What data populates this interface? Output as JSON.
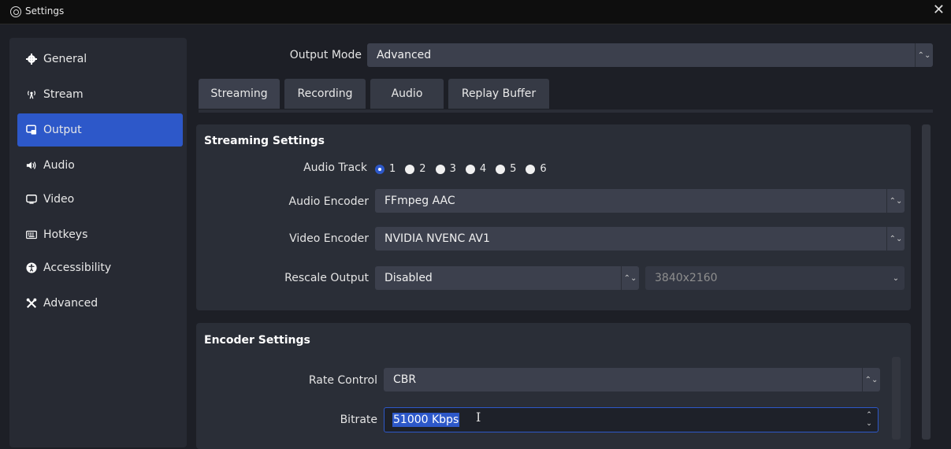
{
  "window": {
    "title": "Settings",
    "close_glyph": "✕"
  },
  "sidebar": {
    "items": [
      {
        "label": "General",
        "icon": "gear-icon",
        "glyph": "✿"
      },
      {
        "label": "Stream",
        "icon": "broadcast-icon",
        "glyph": "⁽ᵞ⁾"
      },
      {
        "label": "Output",
        "icon": "output-icon",
        "glyph": "▭"
      },
      {
        "label": "Audio",
        "icon": "speaker-icon",
        "glyph": "◀)"
      },
      {
        "label": "Video",
        "icon": "monitor-icon",
        "glyph": "▭"
      },
      {
        "label": "Hotkeys",
        "icon": "keyboard-icon",
        "glyph": "⌨"
      },
      {
        "label": "Accessibility",
        "icon": "accessibility-icon",
        "glyph": "⚉"
      },
      {
        "label": "Advanced",
        "icon": "tools-icon",
        "glyph": "✂"
      }
    ],
    "active_index": 2
  },
  "output_mode": {
    "label": "Output Mode",
    "value": "Advanced"
  },
  "tabs": [
    {
      "label": "Streaming"
    },
    {
      "label": "Recording"
    },
    {
      "label": "Audio"
    },
    {
      "label": "Replay Buffer"
    }
  ],
  "streaming_settings": {
    "title": "Streaming Settings",
    "audio_track": {
      "label": "Audio Track",
      "options": [
        "1",
        "2",
        "3",
        "4",
        "5",
        "6"
      ],
      "selected": "1"
    },
    "audio_encoder": {
      "label": "Audio Encoder",
      "value": "FFmpeg AAC"
    },
    "video_encoder": {
      "label": "Video Encoder",
      "value": "NVIDIA NVENC AV1"
    },
    "rescale_output": {
      "label": "Rescale Output",
      "value": "Disabled",
      "resolution": "3840x2160"
    }
  },
  "encoder_settings": {
    "title": "Encoder Settings",
    "rate_control": {
      "label": "Rate Control",
      "value": "CBR"
    },
    "bitrate": {
      "label": "Bitrate",
      "value": "51000 Kbps"
    }
  },
  "colors": {
    "accent": "#2d58c9",
    "background": "#1d1f26",
    "panel": "#2a2e37"
  }
}
